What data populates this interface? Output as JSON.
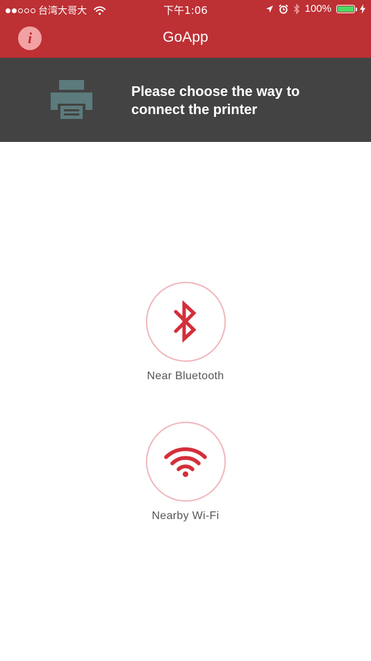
{
  "status_bar": {
    "carrier": "台湾大哥大",
    "time": "下午1:06",
    "battery_percent": "100%",
    "battery_level": 1.0,
    "signal_bars_filled": 2,
    "signal_bars_total": 5
  },
  "nav": {
    "title": "GoApp",
    "info_glyph": "i"
  },
  "banner": {
    "icon": "printer-icon",
    "message": "Please choose the way to connect the printer"
  },
  "options": [
    {
      "icon": "bluetooth-icon",
      "label": "Near Bluetooth"
    },
    {
      "icon": "wifi-icon",
      "label": "Nearby Wi-Fi"
    }
  ],
  "colors": {
    "header_red": "#bd3034",
    "banner_dark": "#434343",
    "printer_icon": "#5b7b7c",
    "accent_red": "#d32f3a",
    "circle_border": "#f0b7bd",
    "info_badge": "#f3a2a4"
  }
}
